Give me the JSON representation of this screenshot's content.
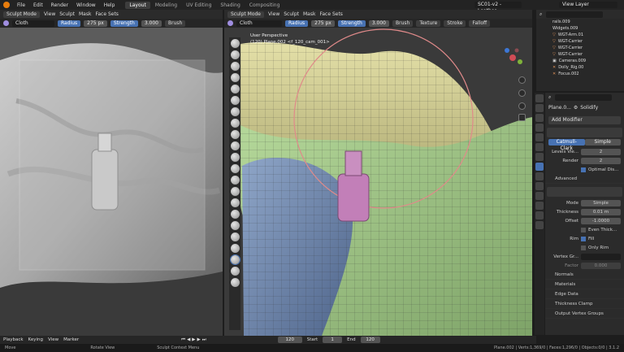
{
  "menu": {
    "items": [
      "File",
      "Edit",
      "Render",
      "Window",
      "Help"
    ]
  },
  "workspaces": [
    {
      "label": "Layout",
      "active": true
    },
    {
      "label": "Modeling",
      "active": false
    },
    {
      "label": "UV Editing",
      "active": false
    },
    {
      "label": "Shading",
      "active": false
    },
    {
      "label": "Compositing",
      "active": false
    }
  ],
  "scene": {
    "name": "SC01-v2 - Leather",
    "view_layer": "View Layer"
  },
  "left_view": {
    "header": [
      "Sculpt Mode",
      "View",
      "Sculpt",
      "Mask",
      "Face Sets"
    ],
    "tool": {
      "brush": "Cloth",
      "radius_label": "Radius",
      "radius": "275 px",
      "strength_label": "Strength",
      "strength": "3.000",
      "brush_menu": "Brush"
    }
  },
  "main_view": {
    "header": [
      "Sculpt Mode",
      "View",
      "Sculpt",
      "Mask",
      "Face Sets"
    ],
    "tool": {
      "brush": "Cloth",
      "radius_label": "Radius",
      "radius": "275 px",
      "strength_label": "Strength",
      "strength": "3.000",
      "menus": [
        "Brush",
        "Texture",
        "Stroke",
        "Falloff"
      ]
    },
    "overlay_title": "User Perspective",
    "overlay_sub": "(120) Plane.002 <f_120_cam_001>"
  },
  "outliner": {
    "items": [
      "rails.009",
      "Widgets.009",
      "WGT-Arm.01",
      "WGT-Carrier",
      "WGT-Carrier",
      "WGT-Carrier",
      "Cameras.009",
      "Dolly_Rig.00",
      "Focus.002"
    ]
  },
  "properties": {
    "object": "Plane.0...",
    "modifier": "Solidify",
    "add_modifier": "Add Modifier",
    "subsurf": {
      "tab_catmull": "Catmull-Clark",
      "tab_simple": "Simple",
      "levels_label": "Levels Vie...",
      "levels": "2",
      "render_label": "Render",
      "render": "2",
      "optimal": "Optimal Dis...",
      "advanced": "Advanced"
    },
    "solidify": {
      "mode_label": "Mode",
      "mode": "Simple",
      "thickness_label": "Thickness",
      "thickness": "0.01 m",
      "offset_label": "Offset",
      "offset": "-1.0000",
      "even": "Even Thick...",
      "rim_label": "Rim",
      "fill": "Fill",
      "only_rim": "Only Rim",
      "vgroup_label": "Vertex Gr...",
      "factor_label": "Factor",
      "factor": "0.000"
    },
    "sections": [
      "Normals",
      "Materials",
      "Edge Data",
      "Thickness Clamp",
      "Output Vertex Groups"
    ]
  },
  "timeline": {
    "items": [
      "Playback",
      "Keying",
      "View",
      "Marker"
    ],
    "frame": "120",
    "start_label": "Start",
    "start": "1",
    "end_label": "End",
    "end": "120"
  },
  "status": {
    "left": "Move",
    "middle": "Rotate View",
    "right": "Sculpt Context Menu",
    "stats": "Plane.002 | Verts:1,369/0 | Faces:1,296/0 | Objects:0/0 | 3.1.2"
  }
}
